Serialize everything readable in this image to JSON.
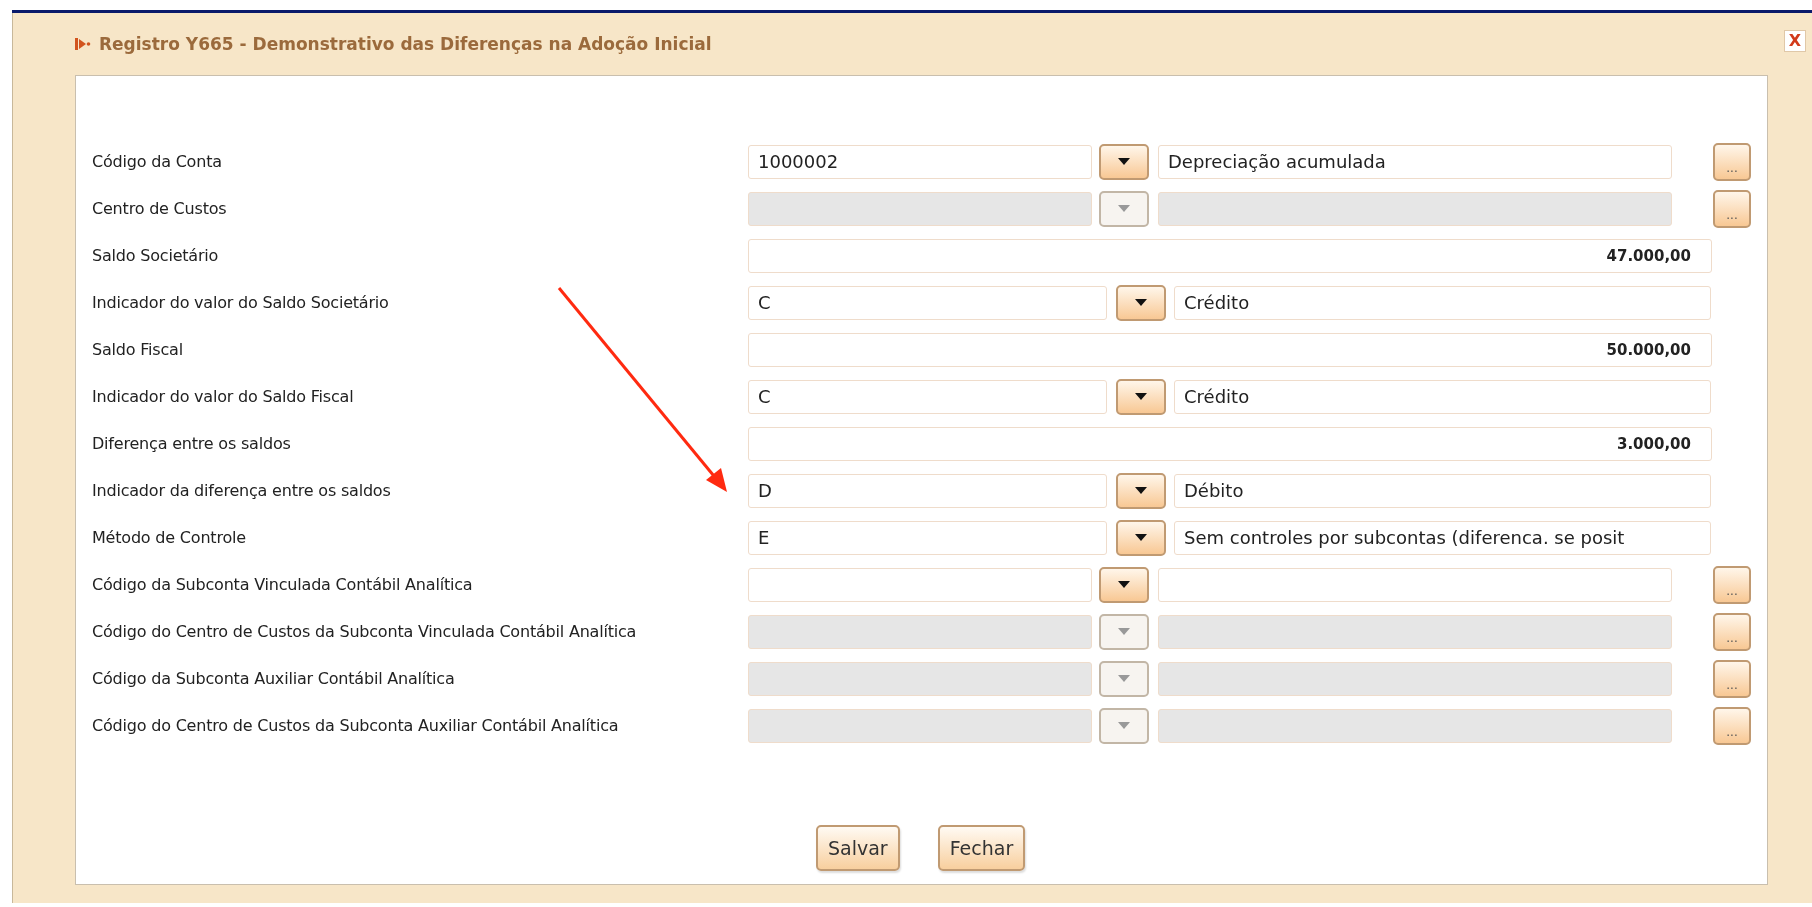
{
  "window": {
    "title": "Registro Y665 - Demonstrativo das Diferenças na Adoção Inicial",
    "close": "X"
  },
  "rows": [
    {
      "label": "Código da Conta",
      "kind": "lookup",
      "code": "1000002",
      "description": "Depreciação acumulada",
      "disabled": false,
      "browse": "..."
    },
    {
      "label": "Centro de Custos",
      "kind": "lookup",
      "disabled": true,
      "browse": "..."
    },
    {
      "label": "Saldo Societário",
      "kind": "amount",
      "value": "47.000,00",
      "disabled": false
    },
    {
      "label": "Indicador do valor do Saldo Societário",
      "kind": "indicator",
      "code": "C",
      "description": "Crédito",
      "disabled": false
    },
    {
      "label": "Saldo Fiscal",
      "kind": "amount",
      "value": "50.000,00",
      "disabled": false
    },
    {
      "label": "Indicador do valor do Saldo Fiscal",
      "kind": "indicator",
      "code": "C",
      "description": "Crédito",
      "disabled": false
    },
    {
      "label": "Diferença entre os saldos",
      "kind": "amount",
      "value": "3.000,00",
      "disabled": false
    },
    {
      "label": "Indicador da diferença entre os saldos",
      "kind": "indicator",
      "code": "D",
      "description": "Débito",
      "disabled": false
    },
    {
      "label": "Método de Controle",
      "kind": "indicator",
      "code": "E",
      "description": "Sem controles por subcontas (diferenca. se posit",
      "disabled": false
    },
    {
      "label": "Código da Subconta Vinculada Contábil Analítica",
      "kind": "lookup",
      "disabled": false,
      "browse": "..."
    },
    {
      "label": "Código do Centro de Custos da Subconta Vinculada Contábil Analítica",
      "kind": "lookup",
      "disabled": true,
      "browse": "..."
    },
    {
      "label": "Código da Subconta Auxiliar Contábil Analítica",
      "kind": "lookup",
      "disabled": true,
      "browse": "..."
    },
    {
      "label": "Código do Centro de Custos da Subconta Auxiliar Contábil Analítica",
      "kind": "lookup",
      "disabled": true,
      "browse": "..."
    }
  ],
  "buttons": [
    "Salvar",
    "Fechar"
  ]
}
